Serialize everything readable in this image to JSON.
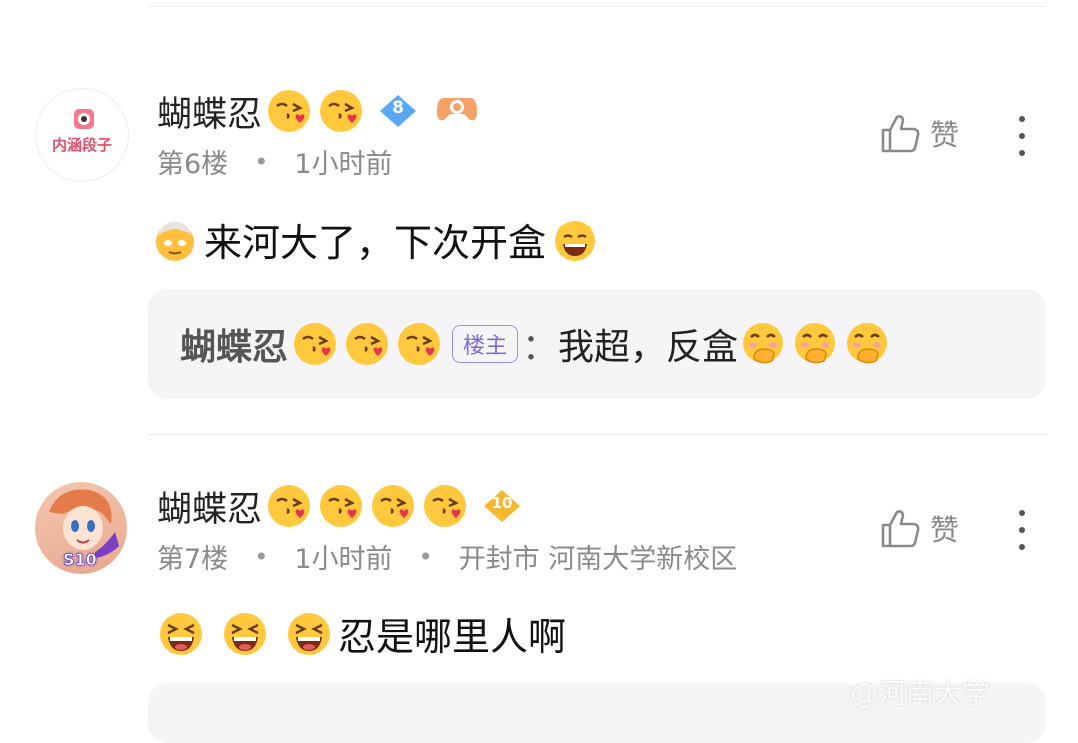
{
  "comments": [
    {
      "username": "蝴蝶忍",
      "level": "8",
      "floor": "第6楼",
      "time": "1小时前",
      "location": "",
      "like_label": "赞",
      "avatar_text": "内涵段子",
      "content": "来河大了，下次开盒",
      "reply": {
        "username": "蝴蝶忍",
        "host_tag": "楼主",
        "separator": "：",
        "text": "我超，反盒"
      }
    },
    {
      "username": "蝴蝶忍",
      "level": "10",
      "floor": "第7楼",
      "time": "1小时前",
      "location": "开封市 河南大学新校区",
      "like_label": "赞",
      "avatar_badge": "S10",
      "content": "忍是哪里人啊"
    }
  ],
  "watermark": "@河南大学"
}
